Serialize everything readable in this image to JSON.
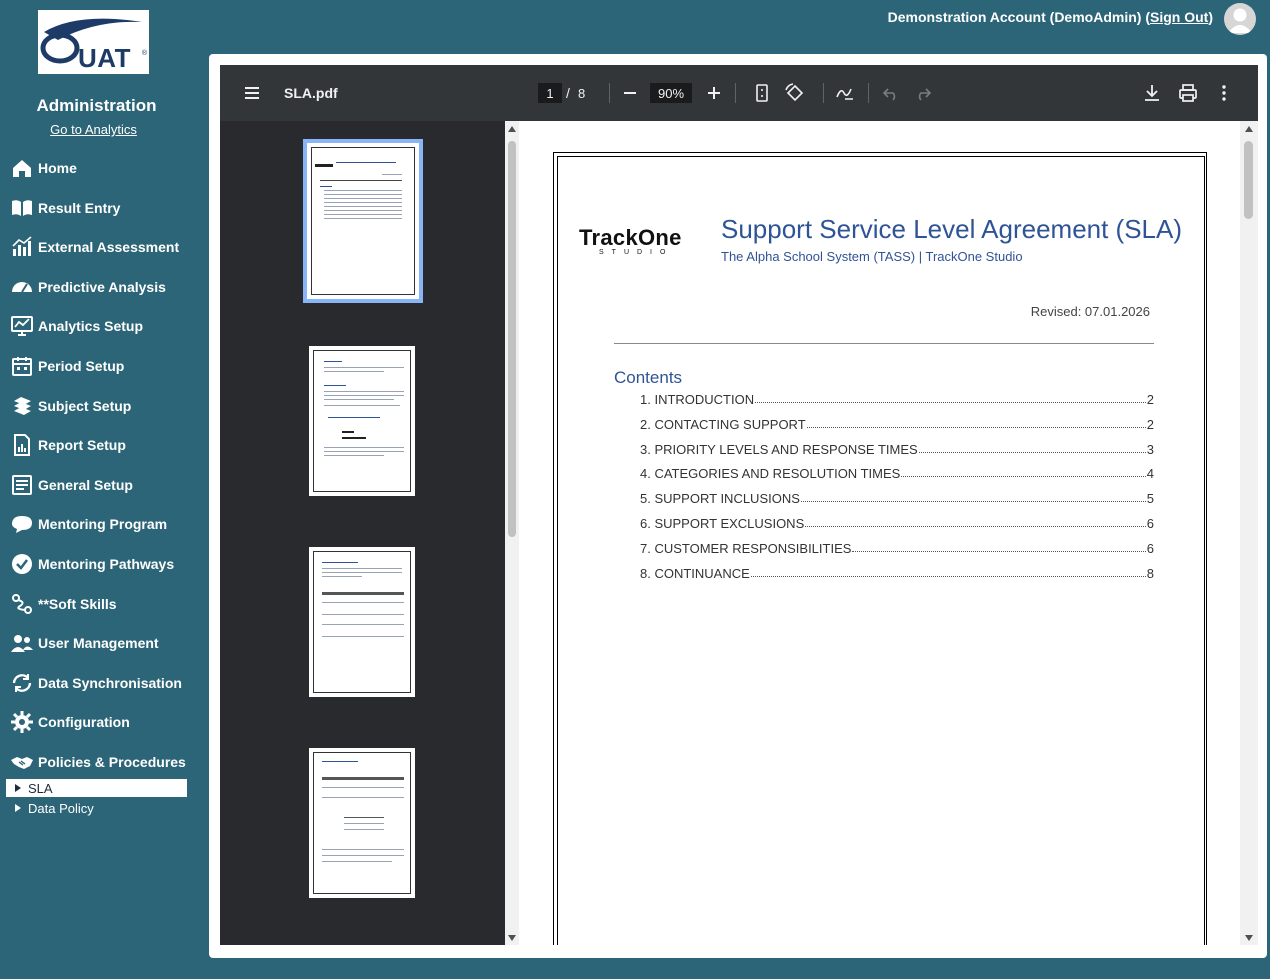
{
  "brand": {
    "logo_text": "UAT",
    "logo_mark": "®"
  },
  "sidebar": {
    "title": "Administration",
    "analytics_link": "Go to Analytics",
    "items": [
      {
        "label": "Home",
        "icon": "home-icon"
      },
      {
        "label": "Result Entry",
        "icon": "book-open-icon"
      },
      {
        "label": "External Assessment",
        "icon": "bar-chart-icon"
      },
      {
        "label": "Predictive Analysis",
        "icon": "gauge-icon"
      },
      {
        "label": "Analytics Setup",
        "icon": "chart-monitor-icon"
      },
      {
        "label": "Period Setup",
        "icon": "calendar-icon"
      },
      {
        "label": "Subject Setup",
        "icon": "books-stack-icon"
      },
      {
        "label": "Report Setup",
        "icon": "report-icon"
      },
      {
        "label": "General Setup",
        "icon": "checklist-icon"
      },
      {
        "label": "Mentoring Program",
        "icon": "chat-icon"
      },
      {
        "label": "Mentoring Pathways",
        "icon": "check-badge-icon"
      },
      {
        "label": "**Soft Skills",
        "icon": "route-icon"
      },
      {
        "label": "User Management",
        "icon": "users-icon"
      },
      {
        "label": "Data Synchronisation",
        "icon": "sync-icon"
      },
      {
        "label": "Configuration",
        "icon": "gear-icon"
      },
      {
        "label": "Policies & Procedures",
        "icon": "handshake-icon"
      }
    ],
    "sub_items": [
      {
        "label": "SLA",
        "active": true
      },
      {
        "label": "Data Policy",
        "active": false
      }
    ]
  },
  "header": {
    "account": "Demonstration Account (DemoAdmin)",
    "signout_open": "(",
    "signout": "Sign Out",
    "signout_close": ")"
  },
  "viewer": {
    "file_name": "SLA.pdf",
    "current_page": "1",
    "page_separator": "/",
    "total_pages": "8",
    "zoom": "90%",
    "thumbnails": [
      "1",
      "2",
      "3",
      "4"
    ],
    "selected_thumbnail": 1
  },
  "document": {
    "logo_word": "TrackOne",
    "logo_sub": "STUDIO",
    "title": "Support Service Level Agreement (SLA)",
    "subtitle": "The Alpha School System (TASS) |  TrackOne Studio",
    "revised": "Revised: 07.01.2026",
    "contents_heading": "Contents",
    "toc": [
      {
        "title": "1. INTRODUCTION",
        "page": "2"
      },
      {
        "title": "2. CONTACTING SUPPORT",
        "page": "2"
      },
      {
        "title": "3. PRIORITY LEVELS AND RESPONSE TIMES",
        "page": "3"
      },
      {
        "title": "4. CATEGORIES AND RESOLUTION TIMES",
        "page": "4"
      },
      {
        "title": "5. SUPPORT INCLUSIONS",
        "page": "5"
      },
      {
        "title": "6. SUPPORT EXCLUSIONS",
        "page": "6"
      },
      {
        "title": "7. CUSTOMER RESPONSIBILITIES",
        "page": "6"
      },
      {
        "title": "8. CONTINUANCE",
        "page": "8"
      }
    ]
  },
  "colors": {
    "background": "#2c6577",
    "toolbar": "#323639",
    "thumb_pane": "#282a2d",
    "selected_thumb": "#8ab4f8",
    "doc_blue": "#2f5496"
  }
}
